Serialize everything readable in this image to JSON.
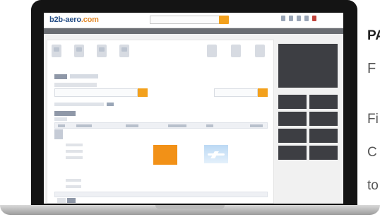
{
  "site": {
    "logo_prefix": "b2b-aero",
    "logo_suffix": ".com"
  },
  "side_text": {
    "line1": "PA",
    "line2": "F",
    "line3": "Fi",
    "line4": "C",
    "line5": "to"
  },
  "colors": {
    "accent_orange": "#f29117",
    "brand_blue": "#274f87",
    "sidebar_dark": "#3d3e43"
  },
  "icons": [
    "search-icon",
    "user-icon",
    "mail-icon",
    "alert-icon",
    "flag-icon"
  ]
}
